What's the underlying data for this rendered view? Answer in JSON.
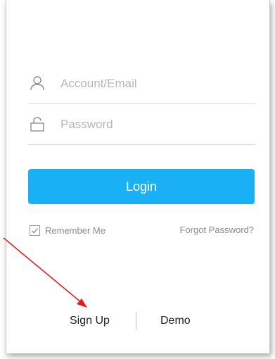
{
  "form": {
    "account_placeholder": "Account/Email",
    "password_placeholder": "Password",
    "account_value": "",
    "password_value": ""
  },
  "login_button": {
    "label": "Login"
  },
  "remember_me": {
    "label": "Remember Me",
    "checked": true
  },
  "forgot_password": {
    "label": "Forgot Password?"
  },
  "footer": {
    "signup_label": "Sign Up",
    "demo_label": "Demo"
  },
  "icons": {
    "account": "user-icon",
    "password": "lock-icon",
    "checkbox": "checkmark-icon"
  },
  "colors": {
    "accent": "#1ab0f5",
    "annotation_arrow": "#e02020"
  }
}
